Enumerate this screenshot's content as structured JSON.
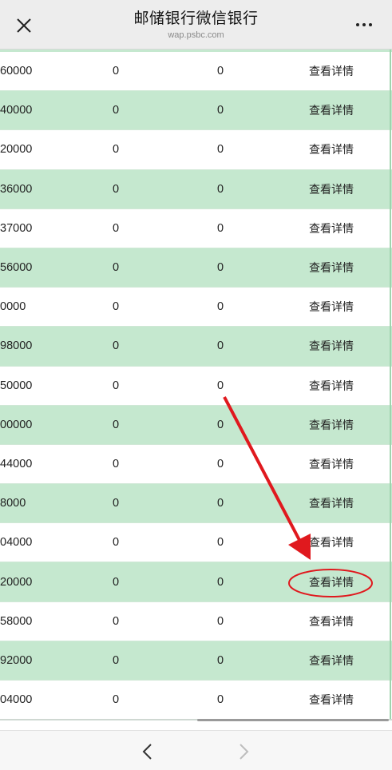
{
  "header": {
    "title": "邮储银行微信银行",
    "url": "wap.psbc.com",
    "close_icon": "close-icon",
    "more_icon": "more-icon"
  },
  "table": {
    "rows": [
      {
        "amount": "60000",
        "col_a": "0",
        "col_b": "0",
        "action": "查看详情"
      },
      {
        "amount": "40000",
        "col_a": "0",
        "col_b": "0",
        "action": "查看详情"
      },
      {
        "amount": "20000",
        "col_a": "0",
        "col_b": "0",
        "action": "查看详情"
      },
      {
        "amount": "36000",
        "col_a": "0",
        "col_b": "0",
        "action": "查看详情"
      },
      {
        "amount": "37000",
        "col_a": "0",
        "col_b": "0",
        "action": "查看详情"
      },
      {
        "amount": "56000",
        "col_a": "0",
        "col_b": "0",
        "action": "查看详情"
      },
      {
        "amount": "0000",
        "col_a": "0",
        "col_b": "0",
        "action": "查看详情"
      },
      {
        "amount": "98000",
        "col_a": "0",
        "col_b": "0",
        "action": "查看详情"
      },
      {
        "amount": "50000",
        "col_a": "0",
        "col_b": "0",
        "action": "查看详情"
      },
      {
        "amount": "00000",
        "col_a": "0",
        "col_b": "0",
        "action": "查看详情"
      },
      {
        "amount": "44000",
        "col_a": "0",
        "col_b": "0",
        "action": "查看详情"
      },
      {
        "amount": "8000",
        "col_a": "0",
        "col_b": "0",
        "action": "查看详情"
      },
      {
        "amount": "04000",
        "col_a": "0",
        "col_b": "0",
        "action": "查看详情"
      },
      {
        "amount": "20000",
        "col_a": "0",
        "col_b": "0",
        "action": "查看详情"
      },
      {
        "amount": "58000",
        "col_a": "0",
        "col_b": "0",
        "action": "查看详情"
      },
      {
        "amount": "92000",
        "col_a": "0",
        "col_b": "0",
        "action": "查看详情"
      },
      {
        "amount": "04000",
        "col_a": "0",
        "col_b": "0",
        "action": "查看详情"
      }
    ]
  },
  "footer": {
    "back_icon": "chevron-left-icon",
    "forward_icon": "chevron-right-icon"
  },
  "colors": {
    "row_green": "#c5e8cf",
    "annotation_red": "#e0191e",
    "header_bg": "#ededed"
  }
}
